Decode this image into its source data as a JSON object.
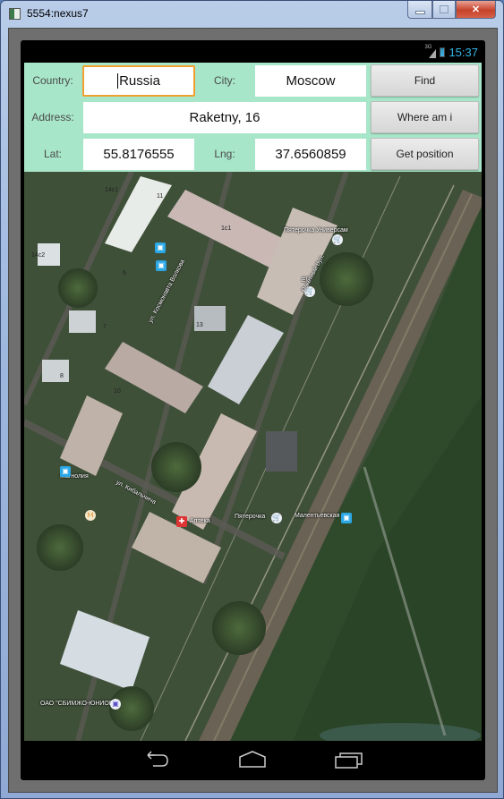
{
  "window": {
    "title": "5554:nexus7",
    "controls": [
      "minimize",
      "maximize",
      "close"
    ]
  },
  "statusbar": {
    "network": "3G",
    "time": "15:37",
    "accent_color": "#33b5e5"
  },
  "form": {
    "background_color": "#a8e6c9",
    "country_label": "Country:",
    "country_value": "Russia",
    "city_label": "City:",
    "city_value": "Moscow",
    "address_label": "Address:",
    "address_value": "Raketny, 16",
    "lat_label": "Lat:",
    "lat_value": "55.8176555",
    "lng_label": "Lng:",
    "lng_value": "37.6560859",
    "find_button": "Find",
    "where_button": "Where am i",
    "position_button": "Get position"
  },
  "map": {
    "type": "satellite",
    "labels": {
      "shop1": "Пятерочка Универсам",
      "shop2": "Ell",
      "cafe": "Магнолия",
      "street1": "ул. Кибальчича",
      "pharmacy": "Аптека",
      "shop3": "Пятерочка",
      "station": "Малентьевская",
      "bank": "ОАО \"СБИМЖО-ЮНИОР\"",
      "bld1": "11",
      "bld2": "14с1",
      "bld3": "14с2",
      "bld4": "6",
      "bld5": "7",
      "bld6": "13",
      "bld7": "10",
      "bld8": "8",
      "bld9": "1с1",
      "street2": "ул. Космонавта Волкова",
      "street3": "Ракетный бул."
    }
  },
  "navbar": {
    "buttons": [
      "back",
      "home",
      "recent-apps"
    ]
  }
}
